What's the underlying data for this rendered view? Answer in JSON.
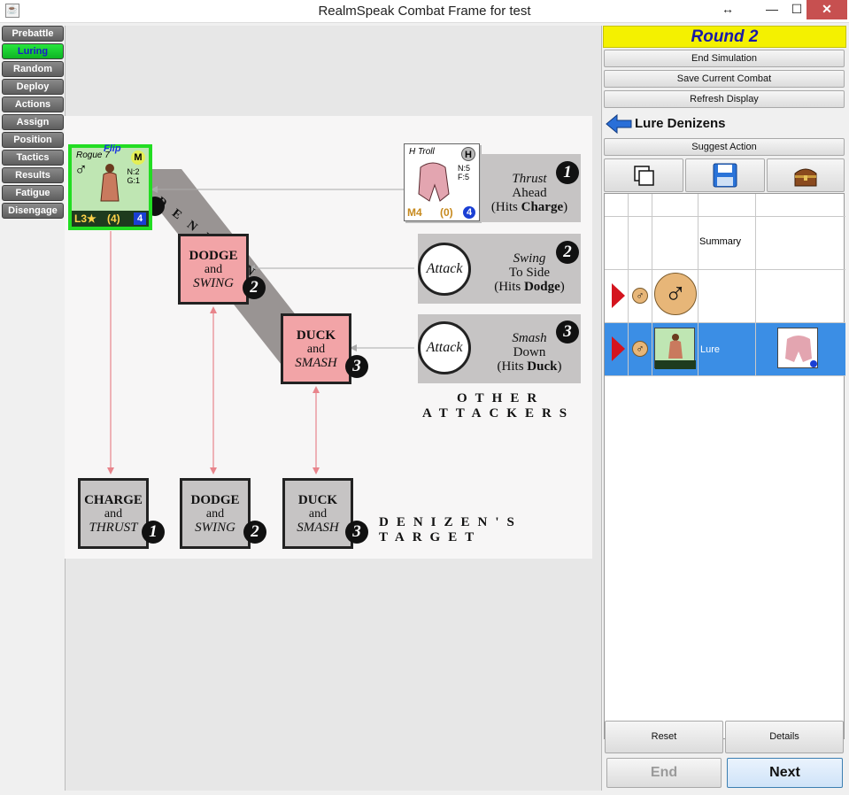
{
  "window": {
    "title": "RealmSpeak Combat Frame for test",
    "icon": "java-icon",
    "controls": {
      "resize": "↔",
      "minimize": "—",
      "maximize": "☐",
      "close": "✕"
    }
  },
  "phases": [
    "Prebattle",
    "Luring",
    "Random",
    "Deploy",
    "Actions",
    "Assign",
    "Position",
    "Tactics",
    "Results",
    "Fatigue",
    "Disengage"
  ],
  "active_phase": "Luring",
  "chart": {
    "denizen_diag": "DENIZEN",
    "rogue_chit": {
      "flip": "Flip",
      "name": "Rogue 7",
      "badge": "M",
      "stat1": "N:2",
      "stat2": "G:1",
      "level": "L3★",
      "value": "(4)",
      "number": "4"
    },
    "troll_chit": {
      "name": "H Troll",
      "badge": "H",
      "stat1": "N:5",
      "stat2": "F:5",
      "level": "M4",
      "value": "(0)",
      "number": "4"
    },
    "attacks": [
      {
        "l1": "Thrust",
        "l2": "Ahead",
        "l3a": "(Hits ",
        "l3b": "Charge",
        "l3c": ")",
        "num": "1"
      },
      {
        "circle": "Attack",
        "l1": "Swing",
        "l2": "To Side",
        "l3a": "(Hits ",
        "l3b": "Dodge",
        "l3c": ")",
        "num": "2"
      },
      {
        "circle": "Attack",
        "l1": "Smash",
        "l2": "Down",
        "l3a": "(Hits ",
        "l3b": "Duck",
        "l3c": ")",
        "num": "3"
      }
    ],
    "other_attackers_1": "OTHER",
    "other_attackers_2": "ATTACKERS",
    "maneuver_boxes": [
      {
        "l1": "DODGE",
        "l2": "and",
        "l3": "SWING",
        "num": "2"
      },
      {
        "l1": "DUCK",
        "l2": "and",
        "l3": "SMASH",
        "num": "3"
      }
    ],
    "target_boxes": [
      {
        "l1": "CHARGE",
        "l2": "and",
        "l3": "THRUST",
        "num": "1"
      },
      {
        "l1": "DODGE",
        "l2": "and",
        "l3": "SWING",
        "num": "2"
      },
      {
        "l1": "DUCK",
        "l2": "and",
        "l3": "SMASH",
        "num": "3"
      }
    ],
    "denizens_target_1": "DENIZEN'S",
    "denizens_target_2": "TARGET"
  },
  "right": {
    "round": "Round 2",
    "end_simulation": "End Simulation",
    "save_combat": "Save Current Combat",
    "refresh": "Refresh Display",
    "lure_heading": "Lure Denizens",
    "suggest": "Suggest Action",
    "tool_icons": [
      "copy-icon",
      "floppy-disk-icon",
      "treasure-chest-icon"
    ],
    "table": {
      "summary": "Summary",
      "row2_label": "Lure",
      "male_symbol": "♂"
    },
    "reset": "Reset",
    "details": "Details",
    "end": "End",
    "next": "Next"
  }
}
